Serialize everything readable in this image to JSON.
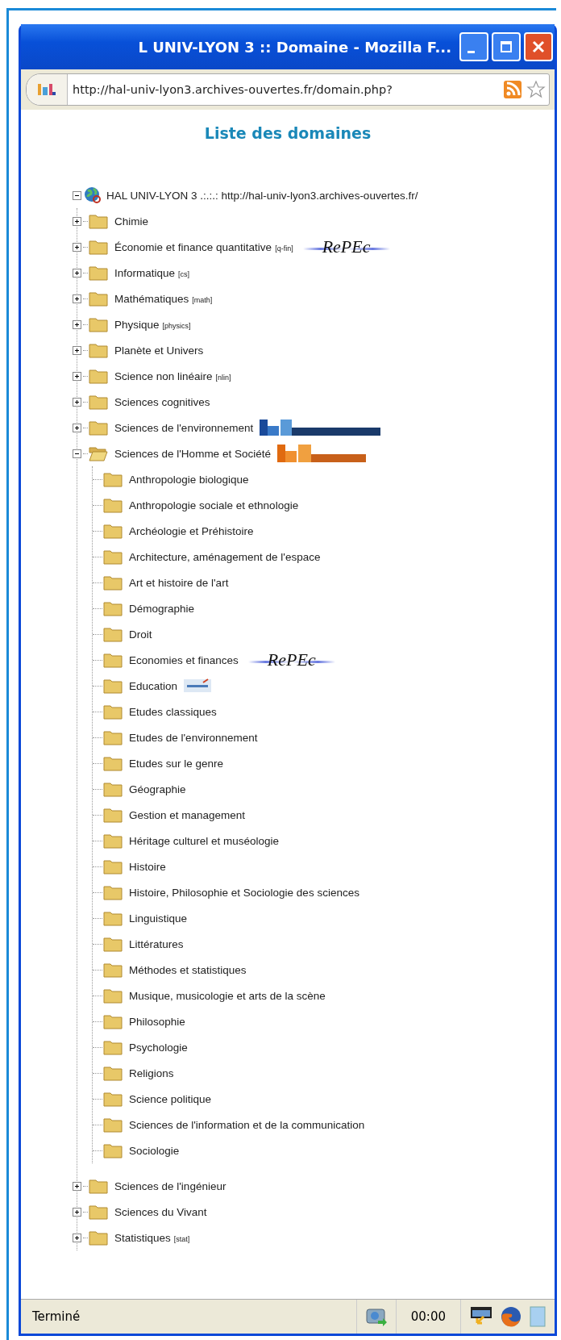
{
  "window": {
    "title": "L UNIV-LYON 3 :: Domaine - Mozilla F..."
  },
  "address_bar": {
    "url": "http://hal-univ-lyon3.archives-ouvertes.fr/domain.php?"
  },
  "page": {
    "heading": "Liste des domaines",
    "tree": {
      "label": "HAL UNIV-LYON 3 .:.:.: http://hal-univ-lyon3.archives-ouvertes.fr/",
      "expanded": true,
      "children": [
        {
          "label": "Chimie",
          "expanded": false
        },
        {
          "label": "Économie et finance quantitative",
          "code": "[q-fin]",
          "expanded": false,
          "logo": {
            "kind": "repec",
            "text": "RePEc"
          }
        },
        {
          "label": "Informatique",
          "code": "[cs]",
          "expanded": false
        },
        {
          "label": "Mathématiques",
          "code": "[math]",
          "expanded": false
        },
        {
          "label": "Physique",
          "code": "[physics]",
          "expanded": false
        },
        {
          "label": "Planète et Univers",
          "expanded": false
        },
        {
          "label": "Science non linéaire",
          "code": "[nlin]",
          "expanded": false
        },
        {
          "label": "Sciences cognitives",
          "expanded": false
        },
        {
          "label": "Sciences de l'environnement",
          "expanded": false,
          "logo": {
            "kind": "hal-blue"
          }
        },
        {
          "label": "Sciences de l'Homme et Société",
          "expanded": true,
          "logo": {
            "kind": "hal-orange"
          },
          "children": [
            {
              "label": "Anthropologie biologique"
            },
            {
              "label": "Anthropologie sociale et ethnologie"
            },
            {
              "label": "Archéologie et Préhistoire"
            },
            {
              "label": "Architecture, aménagement de l'espace"
            },
            {
              "label": "Art et histoire de l'art"
            },
            {
              "label": "Démographie"
            },
            {
              "label": "Droit"
            },
            {
              "label": "Economies et finances",
              "logo": {
                "kind": "repec",
                "text": "RePEc"
              }
            },
            {
              "label": "Education",
              "logo": {
                "kind": "termsciences"
              }
            },
            {
              "label": "Etudes classiques"
            },
            {
              "label": "Etudes de l'environnement"
            },
            {
              "label": "Etudes sur le genre"
            },
            {
              "label": "Géographie"
            },
            {
              "label": "Gestion et management"
            },
            {
              "label": "Héritage culturel et muséologie"
            },
            {
              "label": "Histoire"
            },
            {
              "label": "Histoire, Philosophie et Sociologie des sciences"
            },
            {
              "label": "Linguistique"
            },
            {
              "label": "Littératures"
            },
            {
              "label": "Méthodes et statistiques"
            },
            {
              "label": "Musique, musicologie et arts de la scène"
            },
            {
              "label": "Philosophie"
            },
            {
              "label": "Psychologie"
            },
            {
              "label": "Religions"
            },
            {
              "label": "Science politique"
            },
            {
              "label": "Sciences de l'information et de la communication"
            },
            {
              "label": "Sociologie"
            }
          ]
        },
        {
          "label": "Sciences de l'ingénieur",
          "expanded": false
        },
        {
          "label": "Sciences du Vivant",
          "expanded": false
        },
        {
          "label": "Statistiques",
          "code": "[stat]",
          "expanded": false
        }
      ]
    }
  },
  "status_bar": {
    "text": "Terminé",
    "time": "00:00"
  }
}
